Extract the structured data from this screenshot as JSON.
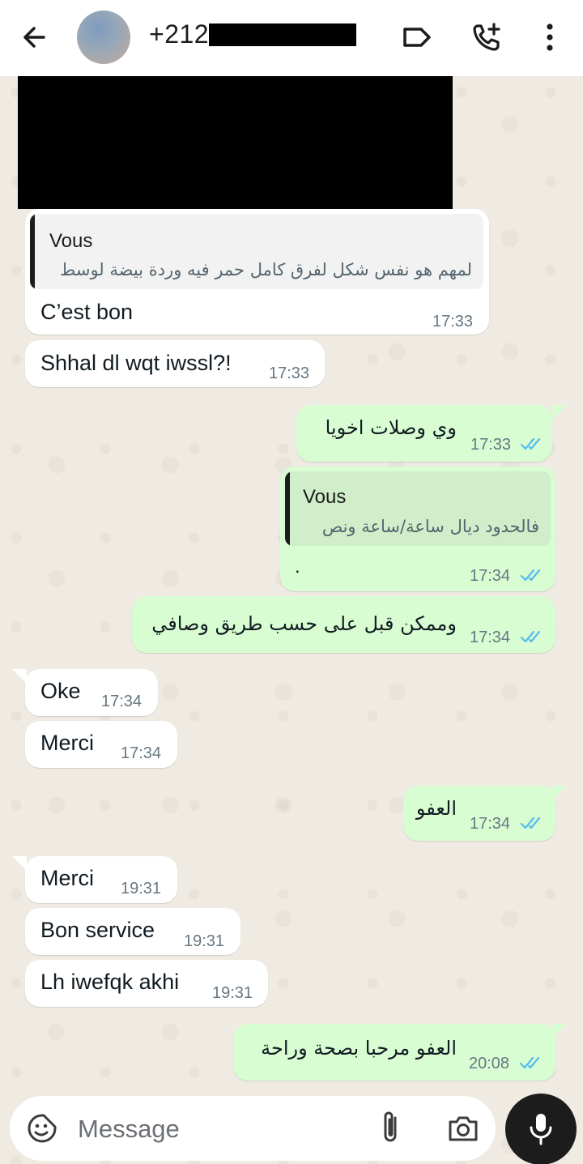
{
  "header": {
    "contact": "+212",
    "back_icon": "arrow-left-icon",
    "label_icon": "label-icon",
    "call_icon": "add-call-icon",
    "more_icon": "more-vertical-icon"
  },
  "colors": {
    "incoming_bubble": "#ffffff",
    "outgoing_bubble": "#d9fdd3",
    "read_ticks": "#53bdeb",
    "chat_background": "#efeae2"
  },
  "messages": [
    {
      "dir": "in",
      "quote_author": "Vous",
      "quote_text": "لمهم هو نفس شكل لفرق كامل حمر فيه وردة بيضة لوسط",
      "text": "C’est bon",
      "time": "17:33"
    },
    {
      "dir": "in",
      "text": "Shhal dl wqt iwssl?!",
      "time": "17:33"
    },
    {
      "dir": "out",
      "text": "وي وصلات اخويا",
      "time": "17:33"
    },
    {
      "dir": "out",
      "quote_author": "Vous",
      "quote_text": "فالحدود ديال ساعة/ساعة ونص",
      "text": ".",
      "time": "17:34"
    },
    {
      "dir": "out",
      "text": "وممكن قبل على حسب طريق وصافي",
      "time": "17:34"
    },
    {
      "dir": "in",
      "text": "Oke",
      "time": "17:34"
    },
    {
      "dir": "in",
      "text": "Merci",
      "time": "17:34"
    },
    {
      "dir": "out",
      "text": "العفو",
      "time": "17:34"
    },
    {
      "dir": "in",
      "text": "Merci",
      "time": "19:31"
    },
    {
      "dir": "in",
      "text": "Bon service",
      "time": "19:31"
    },
    {
      "dir": "in",
      "text": "Lh iwefqk akhi",
      "time": "19:31"
    },
    {
      "dir": "out",
      "text": "العفو مرحبا بصحة وراحة",
      "time": "20:08"
    }
  ],
  "composer": {
    "placeholder": "Message",
    "emoji_icon": "sticker-icon",
    "attach_icon": "paperclip-icon",
    "camera_icon": "camera-icon",
    "mic_icon": "microphone-icon"
  }
}
